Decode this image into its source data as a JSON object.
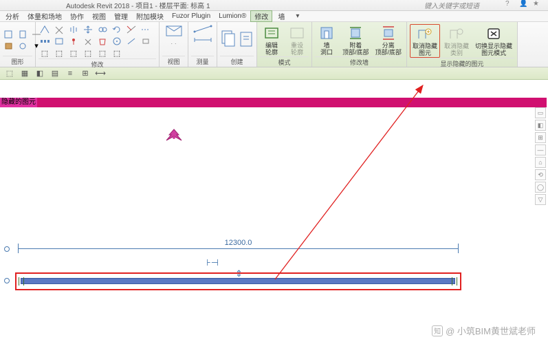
{
  "title": "Autodesk Revit 2018 -   项目1 - 楼层平面: 标高 1",
  "search_hint": "键入关键字或短语",
  "menu": {
    "items": [
      "分析",
      "体量和场地",
      "协作",
      "视图",
      "管理",
      "附加模块",
      "Fuzor Plugin",
      "Lumion®"
    ],
    "active": "修改",
    "context": "墙"
  },
  "ribbon": {
    "groups": [
      {
        "label": "图形",
        "kind": "icons2x2"
      },
      {
        "label": "修改",
        "kind": "modify-grid"
      },
      {
        "label": "视图",
        "kind": "view-icons"
      },
      {
        "label": "测量",
        "kind": "measure"
      },
      {
        "label": "创建",
        "kind": "create"
      },
      {
        "label": "模式",
        "kind": "mode",
        "green": true,
        "btns": [
          {
            "l": "编辑\n轮廓"
          },
          {
            "l": "重设\n轮廓",
            "disabled": true
          }
        ]
      },
      {
        "label": "修改墙",
        "kind": "wall",
        "green": true,
        "btns": [
          {
            "l": "墙\n洞口"
          },
          {
            "l": "附着\n顶部/底部"
          },
          {
            "l": "分离\n顶部/底部"
          }
        ]
      },
      {
        "label": "显示隐藏的图元",
        "kind": "hide",
        "green": true,
        "btns": [
          {
            "l": "取消隐藏\n图元",
            "hl": true
          },
          {
            "l": "取消隐藏\n类别",
            "disabled": true
          },
          {
            "l": "切换显示隐藏\n图元模式",
            "x": true
          }
        ]
      }
    ]
  },
  "hidden_label": "隐藏的图元",
  "dimension": "12300.0",
  "watermark": "@ 小筑BIM黄世斌老师",
  "side_tools": [
    "▭",
    "◧",
    "⊞",
    "—",
    "⌂",
    "⟲",
    "◯",
    "▽"
  ]
}
